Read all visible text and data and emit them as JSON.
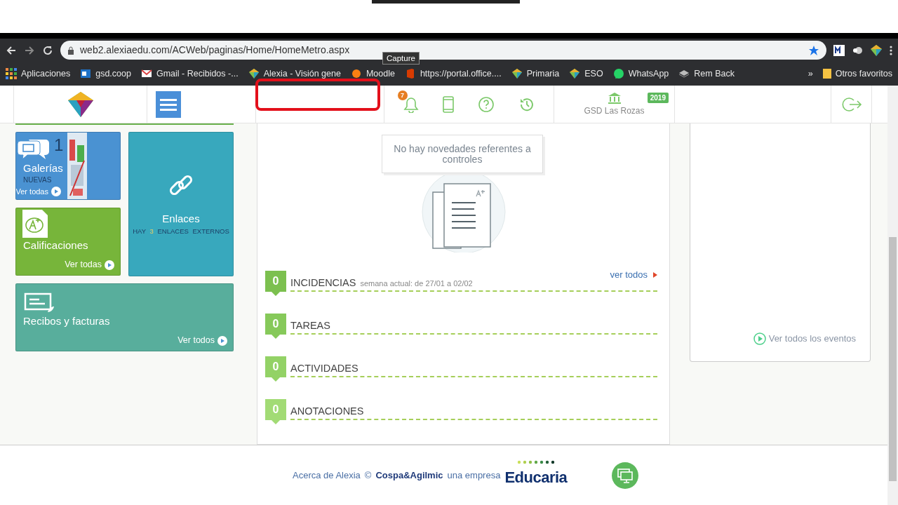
{
  "browser": {
    "url": "web2.alexiaedu.com/ACWeb/paginas/Home/HomeMetro.aspx",
    "tooltip": "Capture",
    "bookmarks": [
      {
        "label": "Aplicaciones",
        "kind": "apps"
      },
      {
        "label": "gsd.coop",
        "kind": "mail"
      },
      {
        "label": "Gmail - Recibidos -...",
        "kind": "gmail"
      },
      {
        "label": "Alexia - Visión gene",
        "kind": "alexia"
      },
      {
        "label": "Moodle",
        "kind": "moodle"
      },
      {
        "label": "https://portal.office....",
        "kind": "office"
      },
      {
        "label": "Primaria",
        "kind": "alexia"
      },
      {
        "label": "ESO",
        "kind": "alexia"
      },
      {
        "label": "WhatsApp",
        "kind": "whatsapp"
      },
      {
        "label": "Rem Back",
        "kind": "layers"
      }
    ],
    "more": "»",
    "other": "Otros favoritos"
  },
  "header": {
    "notifications": "7",
    "school": "GSD Las Rozas",
    "year": "2019"
  },
  "tiles": [
    {
      "kind": "galleries",
      "title": "Galerías",
      "count": "1",
      "subtitle": "NUEVAS",
      "link": "Ver todas",
      "color": "#4a92d2"
    },
    {
      "kind": "links",
      "title": "Enlaces",
      "parts": [
        "HAY",
        "3",
        "ENLACES EXTERNOS"
      ],
      "color": "#38a8bd"
    },
    {
      "kind": "grades",
      "title": "Calificaciones",
      "link": "Ver todas",
      "color": "#77b53a"
    },
    {
      "kind": "receipts",
      "title": "Recibos y facturas",
      "link": "Ver todos",
      "color": "#58ae9c"
    }
  ],
  "controls": {
    "message": "No hay novedades referentes a controles"
  },
  "sections": [
    {
      "count": "0",
      "title": "INCIDENCIAS",
      "note": "semana actual: de 27/01 a 02/02",
      "link": "ver todos",
      "color": "#7cc04f"
    },
    {
      "count": "0",
      "title": "TAREAS",
      "color": "#86c95a"
    },
    {
      "count": "0",
      "title": "ACTIVIDADES",
      "color": "#93d266"
    },
    {
      "count": "0",
      "title": "ANOTACIONES",
      "color": "#a2db75"
    }
  ],
  "events": {
    "link": "Ver todos los eventos"
  },
  "footer": {
    "about": "Acerca de Alexia",
    "copyright": "©",
    "company": "Cospa&Agilmic",
    "text": "una empresa",
    "brand": "Educaria"
  }
}
